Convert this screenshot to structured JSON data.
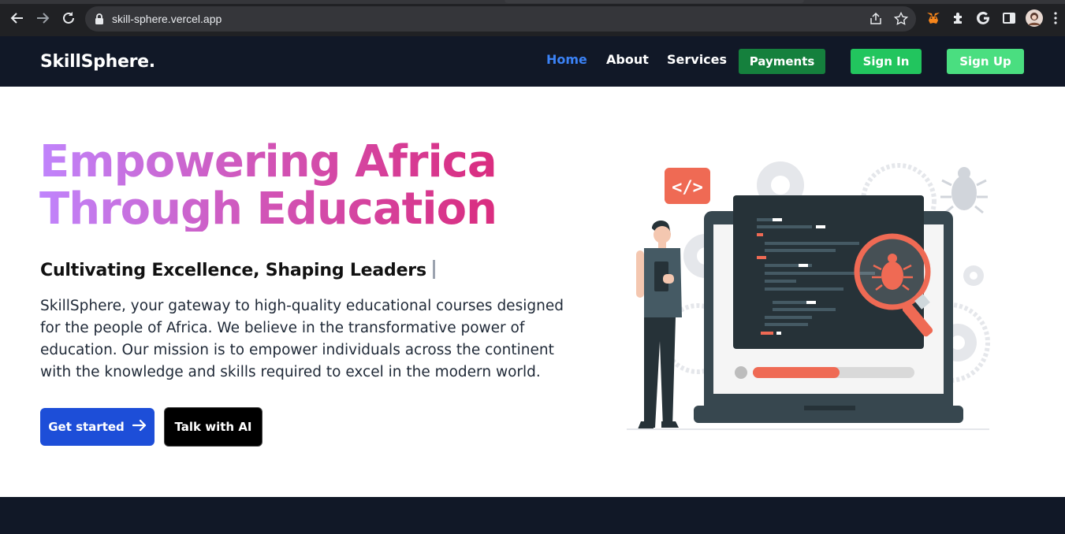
{
  "browser": {
    "url": "skill-sphere.vercel.app",
    "icons": [
      "back-icon",
      "forward-icon",
      "reload-icon",
      "lock-icon",
      "share-icon",
      "star-icon",
      "metamask-icon",
      "extensions-icon",
      "google-icon",
      "sidepanel-icon",
      "profile-avatar",
      "menu-icon"
    ]
  },
  "nav": {
    "logo": "SkillSphere.",
    "links": [
      "Home",
      "About",
      "Services"
    ],
    "payments": "Payments",
    "sign_in": "Sign In",
    "sign_up": "Sign Up",
    "colors": {
      "bg": "#111827",
      "active": "#3b82f6",
      "payments": "#15803d",
      "sign_in": "#22c55e",
      "sign_up": "#4ade80"
    }
  },
  "hero": {
    "title_line1": "Empowering Africa",
    "title_line2": "Through Education",
    "subtitle": "Cultivating Excellence, Shaping Leaders",
    "description": "SkillSphere, your gateway to high-quality educational courses designed for the people of Africa. We believe in the transformative power of education. Our mission is to empower individuals across the continent with the knowledge and skills required to excel in the modern world.",
    "cta_primary": "Get started",
    "cta_secondary": "Talk with AI",
    "code_badge": "</>",
    "title_gradient": [
      "#c084fc",
      "#d155b8",
      "#db2777"
    ]
  }
}
